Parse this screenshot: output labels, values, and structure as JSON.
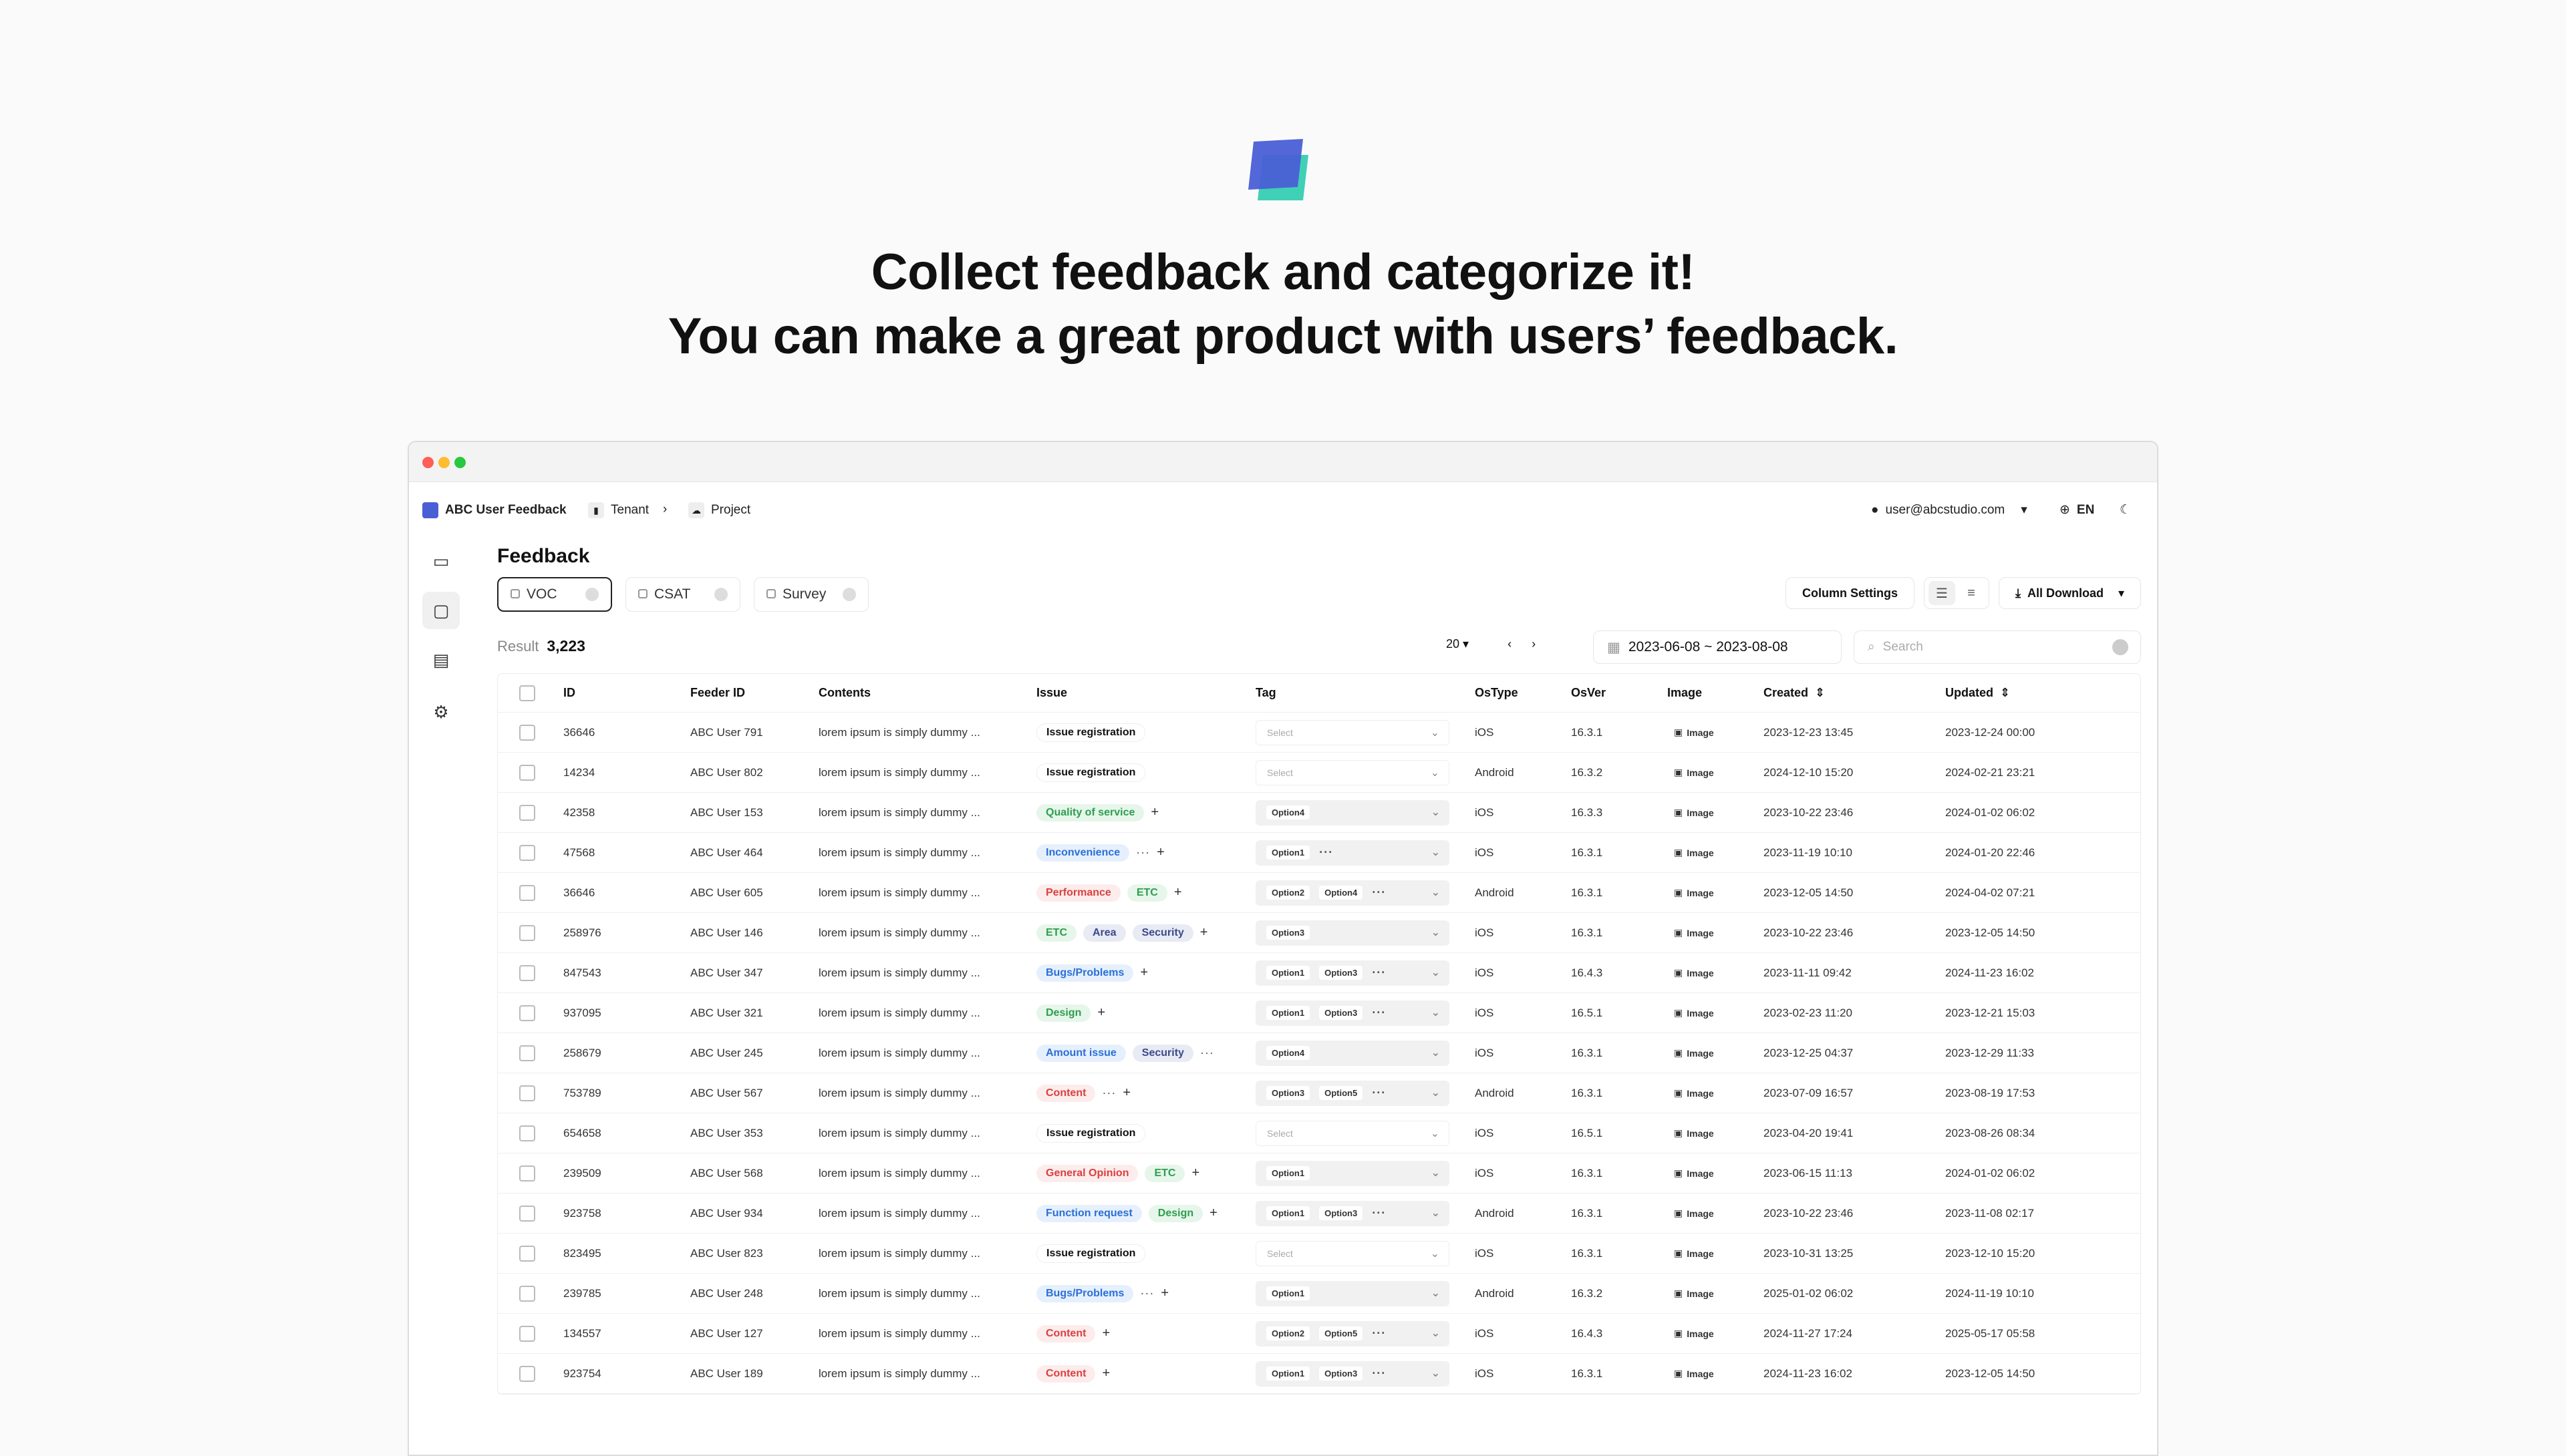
{
  "hero": {
    "line1": "Collect feedback and categorize it!",
    "line2": "You can make a great product with users’ feedback."
  },
  "topbar": {
    "app_name": "ABC User Feedback",
    "breadcrumb_tenant": "Tenant",
    "breadcrumb_project": "Project",
    "user_email": "user@abcstudio.com",
    "language": "EN"
  },
  "page": {
    "title": "Feedback",
    "tabs": [
      {
        "label": "VOC",
        "active": true
      },
      {
        "label": "CSAT",
        "active": false
      },
      {
        "label": "Survey",
        "active": false
      }
    ],
    "column_settings": "Column Settings",
    "all_download": "All Download",
    "result_label": "Result",
    "result_count": "3,223",
    "page_size": "20",
    "date_range": "2023-06-08 ~ 2023-08-08",
    "search_placeholder": "Search"
  },
  "table": {
    "headers": [
      "ID",
      "Feeder ID",
      "Contents",
      "Issue",
      "Tag",
      "OsType",
      "OsVer",
      "Image",
      "Created",
      "Updated"
    ],
    "image_label": "Image",
    "tag_placeholder": "Select",
    "rows": [
      {
        "id": "36646",
        "feeder": "ABC User 791",
        "contents": "lorem ipsum is simply dummy ...",
        "issues": [
          {
            "t": "Issue registration",
            "c": "plain"
          }
        ],
        "issue_more": false,
        "issue_plus": false,
        "tags": [],
        "tag_more": false,
        "os": "iOS",
        "ver": "16.3.1",
        "created": "2023-12-23 13:45",
        "updated": "2023-12-24 00:00"
      },
      {
        "id": "14234",
        "feeder": "ABC User 802",
        "contents": "lorem ipsum is simply dummy ...",
        "issues": [
          {
            "t": "Issue registration",
            "c": "plain"
          }
        ],
        "issue_more": false,
        "issue_plus": false,
        "tags": [],
        "tag_more": false,
        "os": "Android",
        "ver": "16.3.2",
        "created": "2024-12-10 15:20",
        "updated": "2024-02-21 23:21"
      },
      {
        "id": "42358",
        "feeder": "ABC User 153",
        "contents": "lorem ipsum is simply dummy ...",
        "issues": [
          {
            "t": "Quality of service",
            "c": "green"
          }
        ],
        "issue_more": false,
        "issue_plus": true,
        "tags": [
          "Option4"
        ],
        "tag_more": false,
        "os": "iOS",
        "ver": "16.3.3",
        "created": "2023-10-22 23:46",
        "updated": "2024-01-02 06:02"
      },
      {
        "id": "47568",
        "feeder": "ABC User 464",
        "contents": "lorem ipsum is simply dummy ...",
        "issues": [
          {
            "t": "Inconvenience",
            "c": "blue"
          }
        ],
        "issue_more": true,
        "issue_plus": true,
        "tags": [
          "Option1"
        ],
        "tag_more": true,
        "os": "iOS",
        "ver": "16.3.1",
        "created": "2023-11-19 10:10",
        "updated": "2024-01-20 22:46"
      },
      {
        "id": "36646",
        "feeder": "ABC User 605",
        "contents": "lorem ipsum is simply dummy ...",
        "issues": [
          {
            "t": "Performance",
            "c": "red"
          },
          {
            "t": "ETC",
            "c": "green"
          }
        ],
        "issue_more": false,
        "issue_plus": true,
        "tags": [
          "Option2",
          "Option4"
        ],
        "tag_more": true,
        "os": "Android",
        "ver": "16.3.1",
        "created": "2023-12-05 14:50",
        "updated": "2024-04-02 07:21"
      },
      {
        "id": "258976",
        "feeder": "ABC User 146",
        "contents": "lorem ipsum is simply dummy ...",
        "issues": [
          {
            "t": "ETC",
            "c": "green"
          },
          {
            "t": "Area",
            "c": "navy"
          },
          {
            "t": "Security",
            "c": "navy"
          }
        ],
        "issue_more": false,
        "issue_plus": true,
        "tags": [
          "Option3"
        ],
        "tag_more": false,
        "os": "iOS",
        "ver": "16.3.1",
        "created": "2023-10-22 23:46",
        "updated": "2023-12-05 14:50"
      },
      {
        "id": "847543",
        "feeder": "ABC User 347",
        "contents": "lorem ipsum is simply dummy ...",
        "issues": [
          {
            "t": "Bugs/Problems",
            "c": "blue"
          }
        ],
        "issue_more": false,
        "issue_plus": true,
        "tags": [
          "Option1",
          "Option3"
        ],
        "tag_more": true,
        "os": "iOS",
        "ver": "16.4.3",
        "created": "2023-11-11 09:42",
        "updated": "2024-11-23 16:02"
      },
      {
        "id": "937095",
        "feeder": "ABC User 321",
        "contents": "lorem ipsum is simply dummy ...",
        "issues": [
          {
            "t": "Design",
            "c": "green"
          }
        ],
        "issue_more": false,
        "issue_plus": true,
        "tags": [
          "Option1",
          "Option3"
        ],
        "tag_more": true,
        "os": "iOS",
        "ver": "16.5.1",
        "created": "2023-02-23 11:20",
        "updated": "2023-12-21 15:03"
      },
      {
        "id": "258679",
        "feeder": "ABC User 245",
        "contents": "lorem ipsum is simply dummy ...",
        "issues": [
          {
            "t": "Amount issue",
            "c": "blue"
          },
          {
            "t": "Security",
            "c": "navy"
          }
        ],
        "issue_more": true,
        "issue_plus": false,
        "tags": [
          "Option4"
        ],
        "tag_more": false,
        "os": "iOS",
        "ver": "16.3.1",
        "created": "2023-12-25 04:37",
        "updated": "2023-12-29 11:33"
      },
      {
        "id": "753789",
        "feeder": "ABC User 567",
        "contents": "lorem ipsum is simply dummy ...",
        "issues": [
          {
            "t": "Content",
            "c": "red"
          }
        ],
        "issue_more": true,
        "issue_plus": true,
        "tags": [
          "Option3",
          "Option5"
        ],
        "tag_more": true,
        "os": "Android",
        "ver": "16.3.1",
        "created": "2023-07-09 16:57",
        "updated": "2023-08-19 17:53"
      },
      {
        "id": "654658",
        "feeder": "ABC User 353",
        "contents": "lorem ipsum is simply dummy ...",
        "issues": [
          {
            "t": "Issue registration",
            "c": "plain"
          }
        ],
        "issue_more": false,
        "issue_plus": false,
        "tags": [],
        "tag_more": false,
        "os": "iOS",
        "ver": "16.5.1",
        "created": "2023-04-20 19:41",
        "updated": "2023-08-26 08:34"
      },
      {
        "id": "239509",
        "feeder": "ABC User 568",
        "contents": "lorem ipsum is simply dummy ...",
        "issues": [
          {
            "t": "General Opinion",
            "c": "red"
          },
          {
            "t": "ETC",
            "c": "green"
          }
        ],
        "issue_more": false,
        "issue_plus": true,
        "tags": [
          "Option1"
        ],
        "tag_more": false,
        "os": "iOS",
        "ver": "16.3.1",
        "created": "2023-06-15 11:13",
        "updated": "2024-01-02 06:02"
      },
      {
        "id": "923758",
        "feeder": "ABC User 934",
        "contents": "lorem ipsum is simply dummy ...",
        "issues": [
          {
            "t": "Function request",
            "c": "blue"
          },
          {
            "t": "Design",
            "c": "green"
          }
        ],
        "issue_more": false,
        "issue_plus": true,
        "tags": [
          "Option1",
          "Option3"
        ],
        "tag_more": true,
        "os": "Android",
        "ver": "16.3.1",
        "created": "2023-10-22 23:46",
        "updated": "2023-11-08 02:17"
      },
      {
        "id": "823495",
        "feeder": "ABC User 823",
        "contents": "lorem ipsum is simply dummy ...",
        "issues": [
          {
            "t": "Issue registration",
            "c": "plain"
          }
        ],
        "issue_more": false,
        "issue_plus": false,
        "tags": [],
        "tag_more": false,
        "os": "iOS",
        "ver": "16.3.1",
        "created": "2023-10-31 13:25",
        "updated": "2023-12-10 15:20"
      },
      {
        "id": "239785",
        "feeder": "ABC User 248",
        "contents": "lorem ipsum is simply dummy ...",
        "issues": [
          {
            "t": "Bugs/Problems",
            "c": "blue"
          }
        ],
        "issue_more": true,
        "issue_plus": true,
        "tags": [
          "Option1"
        ],
        "tag_more": false,
        "os": "Android",
        "ver": "16.3.2",
        "created": "2025-01-02 06:02",
        "updated": "2024-11-19 10:10"
      },
      {
        "id": "134557",
        "feeder": "ABC User 127",
        "contents": "lorem ipsum is simply dummy ...",
        "issues": [
          {
            "t": "Content",
            "c": "red"
          }
        ],
        "issue_more": false,
        "issue_plus": true,
        "tags": [
          "Option2",
          "Option5"
        ],
        "tag_more": true,
        "os": "iOS",
        "ver": "16.4.3",
        "created": "2024-11-27 17:24",
        "updated": "2025-05-17 05:58"
      },
      {
        "id": "923754",
        "feeder": "ABC User 189",
        "contents": "lorem ipsum is simply dummy ...",
        "issues": [
          {
            "t": "Content",
            "c": "red"
          }
        ],
        "issue_more": false,
        "issue_plus": true,
        "tags": [
          "Option1",
          "Option3"
        ],
        "tag_more": true,
        "os": "iOS",
        "ver": "16.3.1",
        "created": "2024-11-23 16:02",
        "updated": "2023-12-05 14:50"
      }
    ]
  },
  "colors": {
    "green_bg": "#e6f6ea",
    "green_fg": "#2e9e4f",
    "blue_bg": "#e6f0fd",
    "blue_fg": "#2b6fd6",
    "red_bg": "#fdecec",
    "red_fg": "#d94040",
    "navy_bg": "#e8eaf4",
    "navy_fg": "#3b4a8a",
    "logo_front": "#4a5fd6",
    "logo_back": "#3fd0b5"
  }
}
